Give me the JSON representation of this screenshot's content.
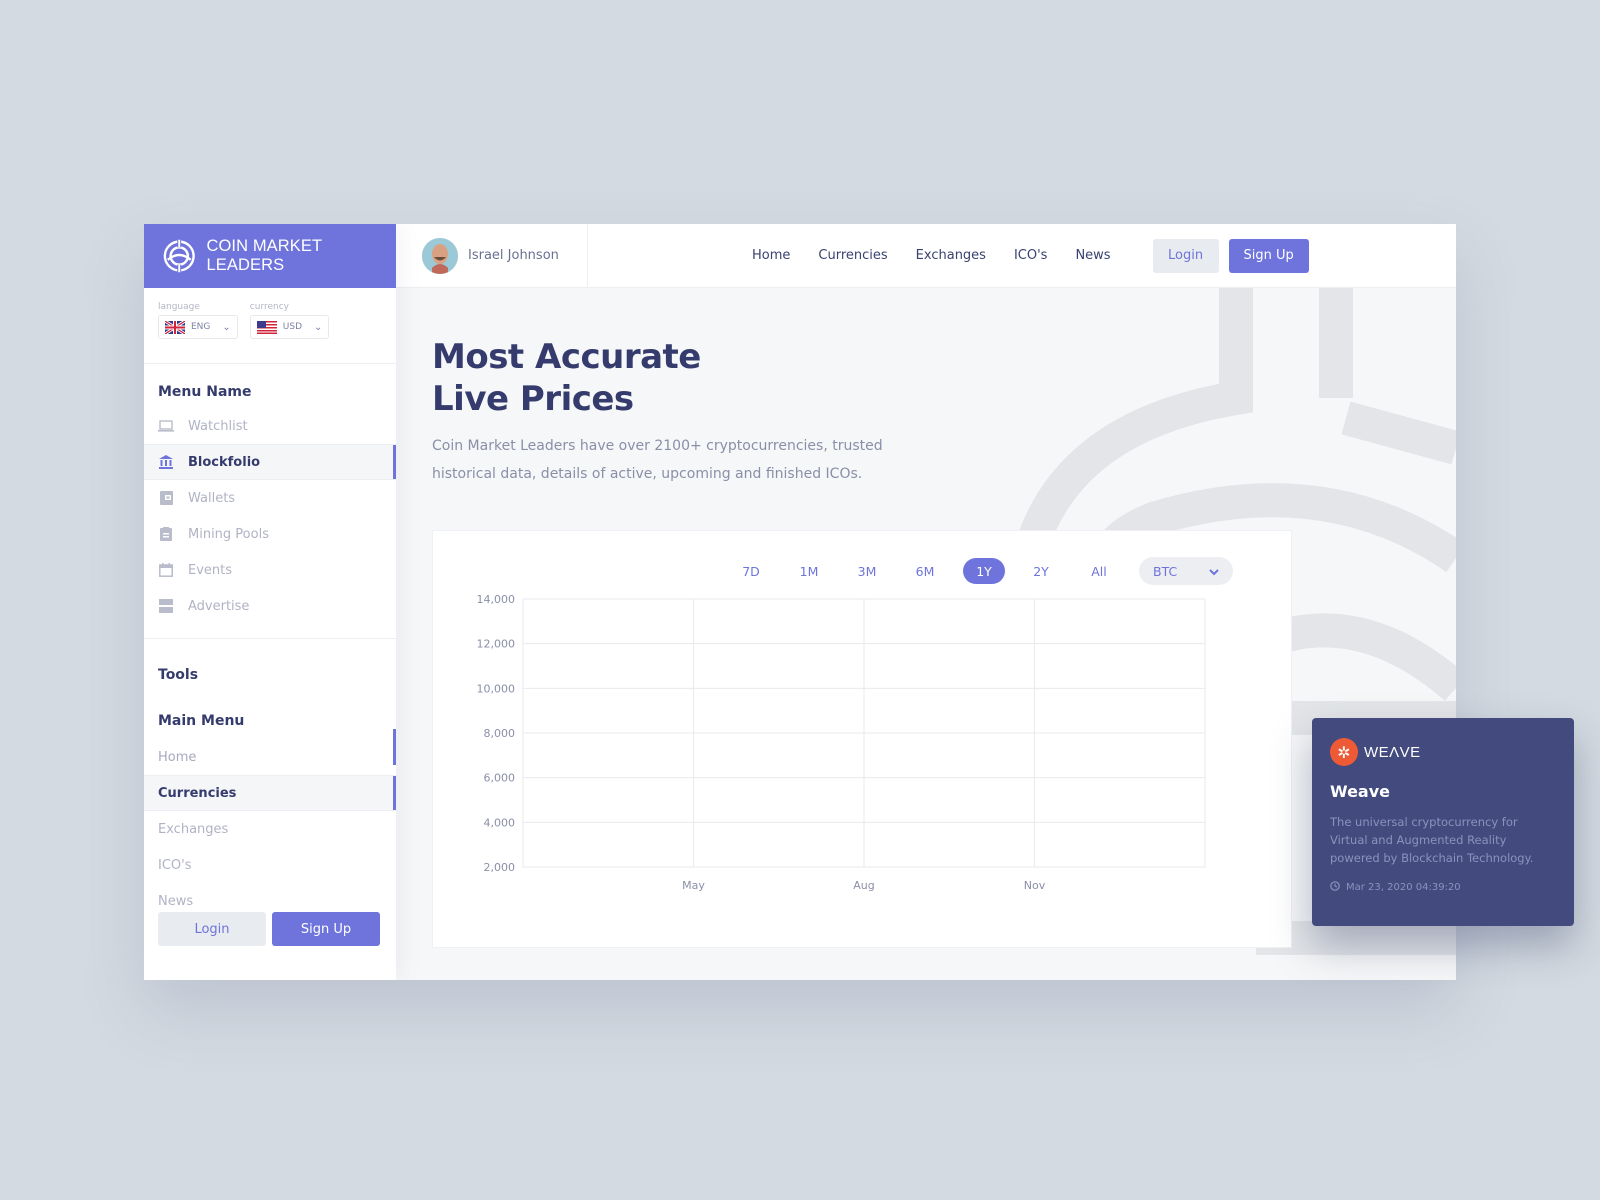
{
  "brand": {
    "name": "COIN MARKET LEADERS",
    "accent": "#6e74db"
  },
  "locale": {
    "language_label": "language",
    "language_value": "ENG",
    "currency_label": "currency",
    "currency_value": "USD"
  },
  "sidebar": {
    "menu_name_title": "Menu Name",
    "menu_items": [
      {
        "label": "Watchlist",
        "icon": "laptop-icon"
      },
      {
        "label": "Blockfolio",
        "icon": "bank-icon",
        "active": true
      },
      {
        "label": "Wallets",
        "icon": "wallet-icon"
      },
      {
        "label": "Mining Pools",
        "icon": "clipboard-icon"
      },
      {
        "label": "Events",
        "icon": "calendar-icon"
      },
      {
        "label": "Advertise",
        "icon": "advertise-icon"
      }
    ],
    "tools_title": "Tools",
    "main_menu_title": "Main Menu",
    "main_menu_items": [
      {
        "label": "Home"
      },
      {
        "label": "Currencies",
        "active": true
      },
      {
        "label": "Exchanges"
      },
      {
        "label": "ICO's"
      },
      {
        "label": "News"
      }
    ],
    "login_label": "Login",
    "signup_label": "Sign Up"
  },
  "topbar": {
    "user_name": "Israel Johnson",
    "nav": [
      "Home",
      "Currencies",
      "Exchanges",
      "ICO's",
      "News"
    ],
    "login_label": "Login",
    "signup_label": "Sign Up"
  },
  "hero": {
    "title_line1": "Most Accurate",
    "title_line2": "Live Prices",
    "description": "Coin Market Leaders have over 2100+ cryptocurrencies, trusted historical data, details of active, upcoming and finished ICOs."
  },
  "chart_controls": {
    "ranges": [
      "7D",
      "1M",
      "3M",
      "6M",
      "1Y",
      "2Y",
      "All"
    ],
    "active_range": "1Y",
    "coin": "BTC"
  },
  "chart_data": {
    "type": "line",
    "title": "",
    "xlabel": "",
    "ylabel": "",
    "y_ticks": [
      "14,000",
      "12,000",
      "10,000",
      "8,000",
      "6,000",
      "4,000",
      "2,000"
    ],
    "ylim": [
      2000,
      14000
    ],
    "x_ticks": [
      "May",
      "Aug",
      "Nov"
    ],
    "grid": true,
    "series": []
  },
  "weave_card": {
    "logo_word": "WEΛVE",
    "title": "Weave",
    "description": "The universal cryptocurrency for Virtual and Augmented Reality powered by Blockchain Technology.",
    "timestamp": "Mar 23, 2020 04:39:20"
  }
}
